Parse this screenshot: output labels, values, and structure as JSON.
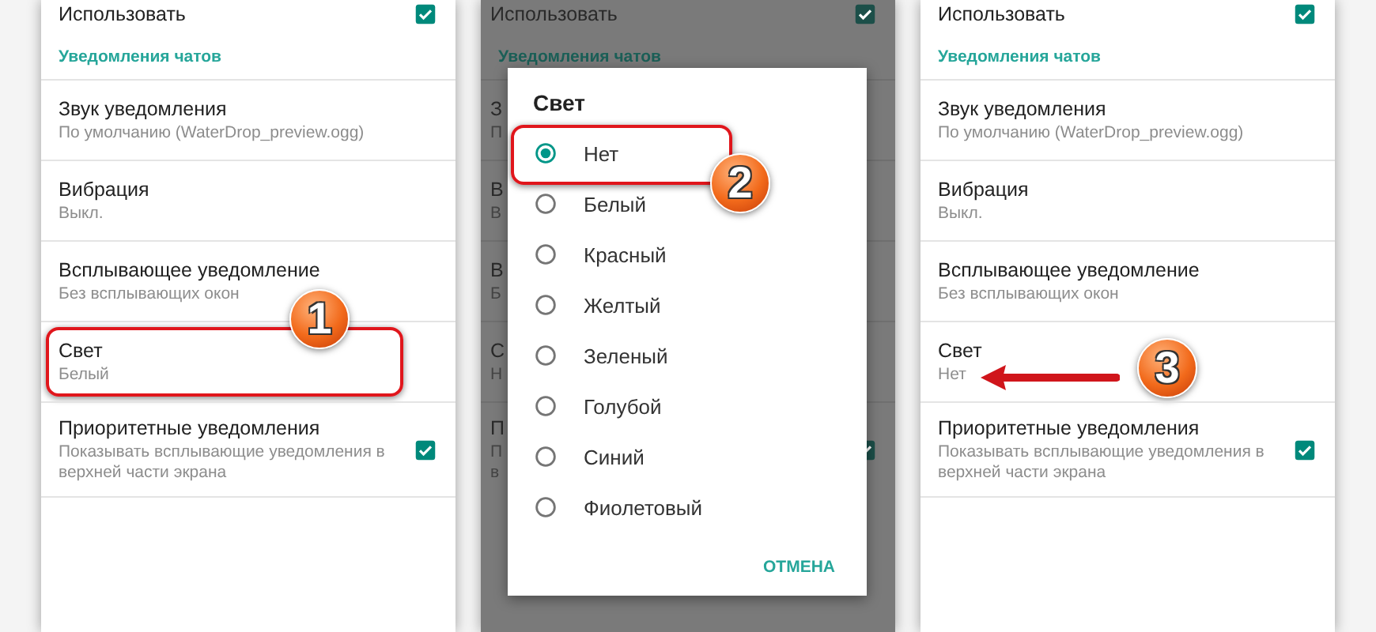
{
  "panels": [
    {
      "dimmed": false,
      "items": [
        {
          "kind": "checkbox",
          "title": "Использовать",
          "checked": true
        },
        {
          "kind": "section",
          "title": "Уведомления чатов"
        },
        {
          "kind": "setting",
          "title": "Звук уведомления",
          "subtitle": [
            "По умолчанию (WaterDrop_preview.ogg)"
          ]
        },
        {
          "kind": "setting",
          "title": "Вибрация",
          "subtitle": [
            "Выкл."
          ]
        },
        {
          "kind": "setting",
          "title": "Всплывающее уведомление",
          "subtitle": [
            "Без всплывающих окон"
          ]
        },
        {
          "kind": "setting",
          "title": "Свет",
          "subtitle": [
            "Белый"
          ],
          "callout": {
            "kind": "box",
            "badge": "1"
          }
        },
        {
          "kind": "checkbox",
          "title": "Приоритетные уведомления",
          "subtitle": [
            "Показывать всплывающие уведомления в",
            "верхней части экрана"
          ],
          "checked": true
        }
      ]
    },
    {
      "dimmed": true,
      "items": [
        {
          "kind": "checkbox",
          "title": "Использовать",
          "checked": true
        },
        {
          "kind": "section",
          "title": "Уведомления чатов"
        },
        {
          "kind": "setting",
          "title": "З",
          "subtitle": [
            "П"
          ]
        },
        {
          "kind": "setting",
          "title": "В",
          "subtitle": [
            "В"
          ]
        },
        {
          "kind": "setting",
          "title": "В",
          "subtitle": [
            "Б"
          ]
        },
        {
          "kind": "setting",
          "title": "С",
          "subtitle": [
            "Н"
          ]
        },
        {
          "kind": "checkbox",
          "title": "П",
          "subtitle": [
            "П",
            "в"
          ],
          "checked": true
        }
      ],
      "dialog": {
        "title": "Свет",
        "options": [
          {
            "label": "Нет",
            "selected": true,
            "callout": {
              "kind": "box",
              "badge": "2"
            }
          },
          {
            "label": "Белый",
            "selected": false
          },
          {
            "label": "Красный",
            "selected": false
          },
          {
            "label": "Желтый",
            "selected": false
          },
          {
            "label": "Зеленый",
            "selected": false
          },
          {
            "label": "Голубой",
            "selected": false
          },
          {
            "label": "Синий",
            "selected": false
          },
          {
            "label": "Фиолетовый",
            "selected": false
          }
        ],
        "button": "ОТМЕНА"
      }
    },
    {
      "dimmed": false,
      "items": [
        {
          "kind": "checkbox",
          "title": "Использовать",
          "checked": true
        },
        {
          "kind": "section",
          "title": "Уведомления чатов"
        },
        {
          "kind": "setting",
          "title": "Звук уведомления",
          "subtitle": [
            "По умолчанию (WaterDrop_preview.ogg)"
          ]
        },
        {
          "kind": "setting",
          "title": "Вибрация",
          "subtitle": [
            "Выкл."
          ]
        },
        {
          "kind": "setting",
          "title": "Всплывающее уведомление",
          "subtitle": [
            "Без всплывающих окон"
          ]
        },
        {
          "kind": "setting",
          "title": "Свет",
          "subtitle": [
            "Нет"
          ],
          "callout": {
            "kind": "arrow",
            "badge": "3"
          }
        },
        {
          "kind": "checkbox",
          "title": "Приоритетные уведомления",
          "subtitle": [
            "Показывать всплывающие уведомления в",
            "верхней части экрана"
          ],
          "checked": true
        }
      ]
    }
  ]
}
